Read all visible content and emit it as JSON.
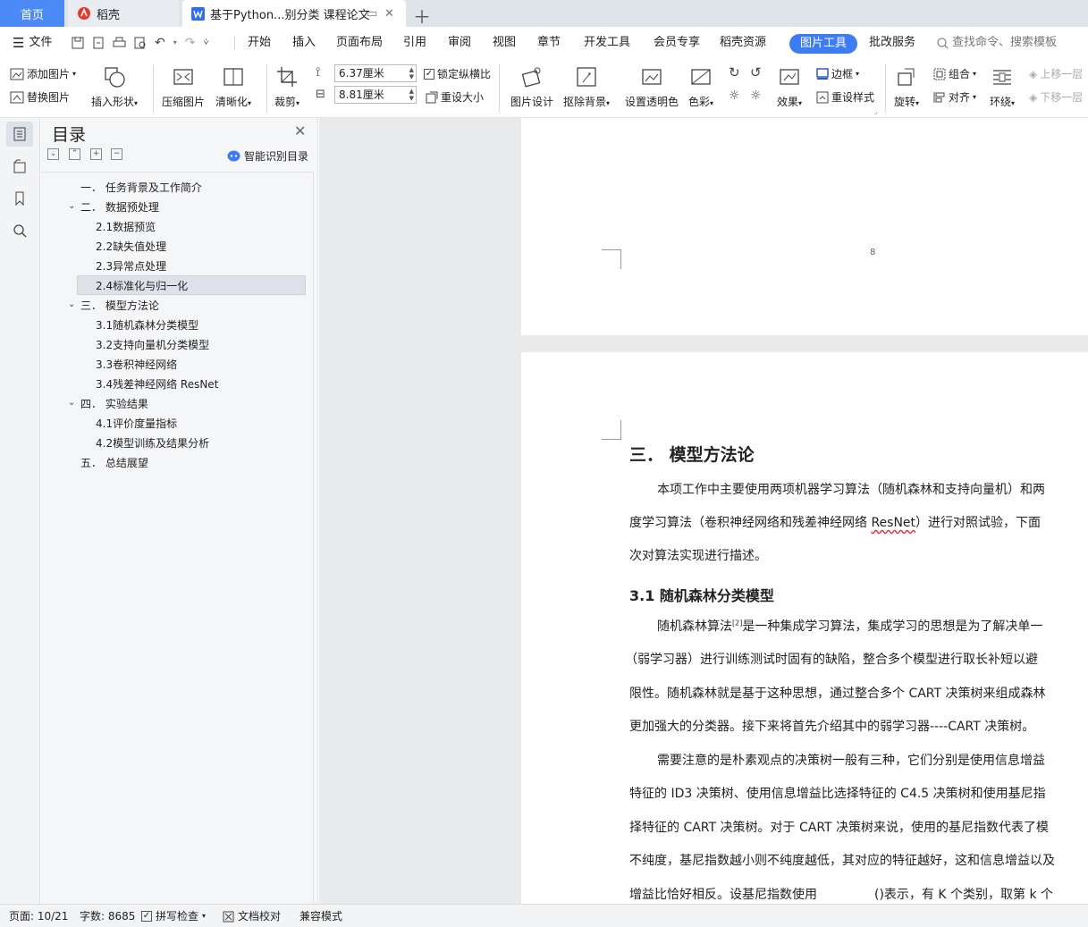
{
  "tabs": {
    "home": "首页",
    "daoke": "稻壳",
    "doc": "基于Python...别分类 课程论文"
  },
  "menu": {
    "file": "文件",
    "items": [
      "开始",
      "插入",
      "页面布局",
      "引用",
      "审阅",
      "视图",
      "章节",
      "开发工具",
      "会员专享",
      "稻壳资源"
    ],
    "picture_tools": "图片工具",
    "review_service": "批改服务",
    "search_placeholder": "查找命令、搜索模板"
  },
  "ribbon": {
    "add_picture": "添加图片",
    "replace_picture": "替换图片",
    "insert_shape": "插入形状",
    "compress": "压缩图片",
    "sharpen": "清晰化",
    "crop": "裁剪",
    "width_value": "6.37厘米",
    "height_value": "8.81厘米",
    "lock_ratio": "锁定纵横比",
    "reset_size": "重设大小",
    "picture_design": "图片设计",
    "remove_bg": "抠除背景",
    "transparent": "设置透明色",
    "color": "色彩",
    "effects": "效果",
    "border": "边框",
    "reset_style": "重设样式",
    "rotate": "旋转",
    "group": "组合",
    "align": "对齐",
    "wrap": "环绕",
    "move_up": "上移一层",
    "move_down": "下移一层"
  },
  "toc": {
    "title": "目录",
    "smart": "智能识别目录",
    "items": [
      {
        "label": "一．  任务背景及工作简介"
      },
      {
        "label": "二．  数据预处理"
      },
      {
        "label": "2.1数据预览"
      },
      {
        "label": "2.2缺失值处理"
      },
      {
        "label": "2.3异常点处理"
      },
      {
        "label": "2.4标准化与归一化"
      },
      {
        "label": "三．  模型方法论"
      },
      {
        "label": "3.1随机森林分类模型"
      },
      {
        "label": "3.2支持向量机分类模型"
      },
      {
        "label": "3.3卷积神经网络"
      },
      {
        "label": "3.4残差神经网络 ResNet"
      },
      {
        "label": "四．  实验结果"
      },
      {
        "label": "4.1评价度量指标"
      },
      {
        "label": "4.2模型训练及结果分析"
      },
      {
        "label": "五．  总结展望"
      }
    ]
  },
  "doc": {
    "page_number": "8",
    "heading": "三．  模型方法论",
    "p1_l1": "本项工作中主要使用两项机器学习算法（随机森林和支持向量机）和两",
    "p1_l2a": "度学习算法（卷积神经网络和残差神经网络 ",
    "p1_l2b": "ResNet",
    "p1_l2c": "）进行对照试验，下面",
    "p1_l3": "次对算法实现进行描述。",
    "sub_heading": "3.1  随机森林分类模型",
    "p2_l1a": "随机森林算法",
    "p2_l1sup": "[2]",
    "p2_l1b": "是一种集成学习算法，集成学习的思想是为了解决单一",
    "p2_l2": "（弱学习器）进行训练测试时固有的缺陷，整合多个模型进行取长补短以避",
    "p2_l3": "限性。随机森林就是基于这种思想，通过整合多个 CART 决策树来组成森林",
    "p2_l4": "更加强大的分类器。接下来将首先介绍其中的弱学习器----CART 决策树。",
    "p3_l1": "需要注意的是朴素观点的决策树一般有三种，它们分别是使用信息增益",
    "p3_l2": "特征的 ID3 决策树、使用信息增益比选择特征的 C4.5 决策树和使用基尼指",
    "p3_l3": "择特征的 CART 决策树。对于 CART 决策树来说，使用的基尼指数代表了模",
    "p3_l4": "不纯度，基尼指数越小则不纯度越低，其对应的特征越好，这和信息增益以及",
    "p3_l5a": "增益比恰好相反。设基尼指数使用",
    "p3_l5b": "()表示，有 K 个类别，取第 k 个"
  },
  "status": {
    "page": "页面: 10/21",
    "words": "字数: 8685",
    "spell": "拼写检查",
    "proof": "文档校对",
    "compat": "兼容模式"
  },
  "colors": {
    "accent": "#3d7cf3",
    "home_tab": "#4c8bf5"
  }
}
